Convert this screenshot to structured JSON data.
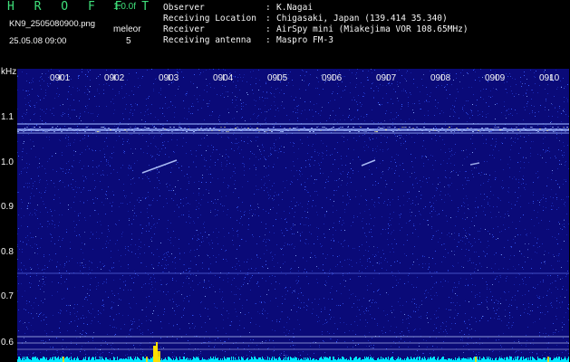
{
  "header": {
    "brand": "H R O F F T",
    "version": "1.0.0f",
    "filename": "KN9_2505080900.png",
    "site_label": "meleor",
    "datetime": "25.05.08 09:00",
    "count": "5",
    "meta": [
      {
        "key": "Observer",
        "value": "K.Nagai"
      },
      {
        "key": "Receiving Location",
        "value": "Chigasaki, Japan (139.414 35.340)"
      },
      {
        "key": "Receiver",
        "value": "AirSpy mini (Miakejima VOR 108.65MHz)"
      },
      {
        "key": "Receiving antenna",
        "value": "Maspro FM-3"
      }
    ]
  },
  "chart_data": {
    "type": "heatmap",
    "ylabel": "kHz",
    "yticks": [
      "1.1",
      "1.0",
      "0.9",
      "0.8",
      "0.7",
      "0.6"
    ],
    "xticks": [
      "0901",
      "0902",
      "0903",
      "0904",
      "0905",
      "0906",
      "0907",
      "0908",
      "0909",
      "0910"
    ],
    "colors": {
      "background": "#0a0a78",
      "noise": "#3a5fff",
      "carrier": "#9ab2ff",
      "baseline": "#00e8ff",
      "peak": "#ffe000"
    }
  }
}
